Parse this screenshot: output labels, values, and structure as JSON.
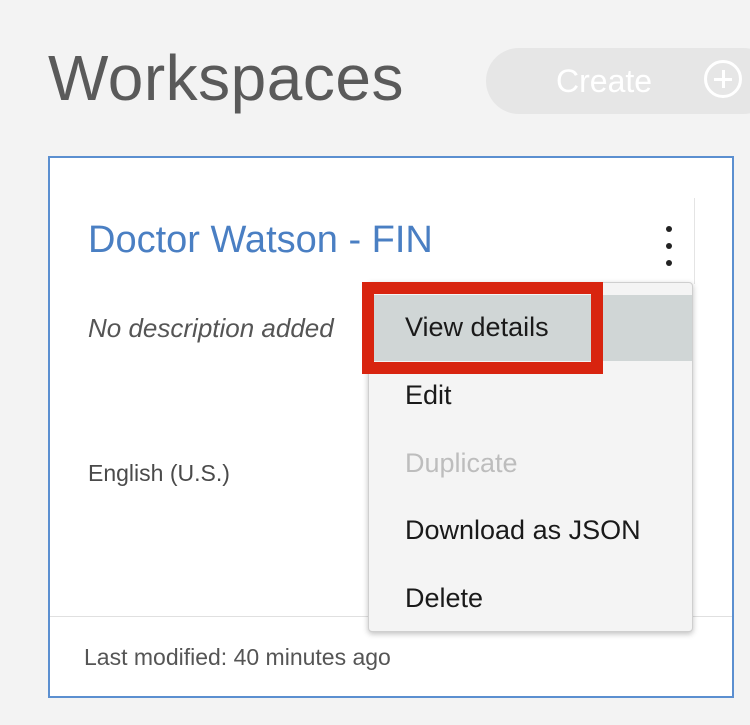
{
  "header": {
    "title": "Workspaces",
    "create_label": "Create"
  },
  "workspace_card": {
    "title": "Doctor Watson - FIN",
    "description": "No description added",
    "language": "English (U.S.)",
    "last_modified": "Last modified: 40 minutes ago"
  },
  "overflow_menu": {
    "items": [
      {
        "label": "View details"
      },
      {
        "label": "Edit"
      },
      {
        "label": "Duplicate"
      },
      {
        "label": "Download as JSON"
      },
      {
        "label": "Delete"
      }
    ]
  },
  "colors": {
    "title_link": "#4a7fc3",
    "card_border": "#5b8fd0",
    "highlight": "#d8240f",
    "disabled_text": "#bdbdbd"
  },
  "icons": {
    "create": "plus-circle-icon",
    "overflow": "overflow-menu-vertical-icon"
  }
}
